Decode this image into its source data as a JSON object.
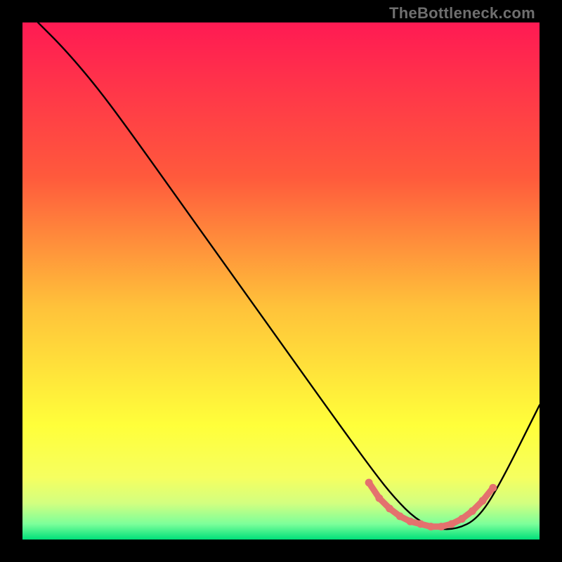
{
  "watermark": "TheBottleneck.com",
  "chart_data": {
    "type": "line",
    "title": "",
    "xlabel": "",
    "ylabel": "",
    "xlim": [
      0,
      100
    ],
    "ylim": [
      0,
      100
    ],
    "grid": false,
    "legend": false,
    "gradient_stops": [
      {
        "offset": 0,
        "color": "#ff1a53"
      },
      {
        "offset": 0.3,
        "color": "#ff5a3c"
      },
      {
        "offset": 0.55,
        "color": "#ffc23a"
      },
      {
        "offset": 0.78,
        "color": "#ffff3a"
      },
      {
        "offset": 0.88,
        "color": "#f6ff60"
      },
      {
        "offset": 0.93,
        "color": "#d2ff80"
      },
      {
        "offset": 0.97,
        "color": "#7cff9a"
      },
      {
        "offset": 1.0,
        "color": "#00e07a"
      }
    ],
    "series": [
      {
        "name": "curve",
        "color": "#000000",
        "width": 2.4,
        "x": [
          3,
          8,
          14,
          20,
          30,
          40,
          50,
          60,
          68,
          72,
          76,
          80,
          84,
          88,
          92,
          100
        ],
        "y": [
          100,
          95,
          88,
          80,
          66,
          52,
          38,
          24,
          13,
          8,
          4,
          2,
          2,
          4,
          10,
          26
        ]
      },
      {
        "name": "valley-dots",
        "color": "#e4716e",
        "type": "scatter",
        "marker_size": 9,
        "x": [
          67,
          69,
          71,
          73,
          75,
          77,
          79,
          81,
          83,
          85,
          87,
          89,
          91
        ],
        "y": [
          11,
          8,
          6,
          4.5,
          3.5,
          3,
          2.5,
          2.5,
          3,
          4,
          5.5,
          7.5,
          10
        ]
      }
    ]
  }
}
